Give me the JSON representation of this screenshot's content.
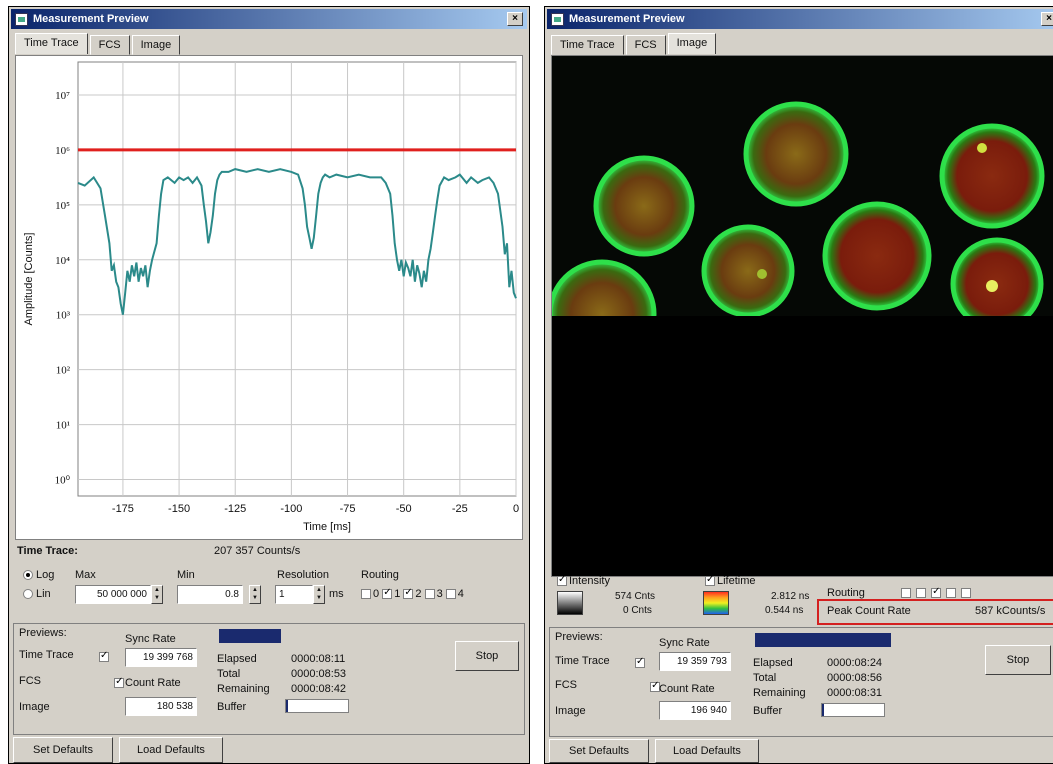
{
  "left_window": {
    "title": "Measurement Preview",
    "close_glyph": "×",
    "tabs": [
      "Time Trace",
      "FCS",
      "Image"
    ],
    "active_tab": "Time Trace",
    "chart_data": {
      "type": "line",
      "xlabel": "Time [ms]",
      "ylabel": "Amplitude [Counts]",
      "x_ticks": [
        "-175",
        "-150",
        "-125",
        "-100",
        "-75",
        "-50",
        "-25",
        "0"
      ],
      "y_ticks": [
        "10⁷",
        "10⁶",
        "10⁵",
        "10⁴",
        "10³",
        "10²",
        "10¹",
        "10⁰"
      ],
      "xlim": [
        -195,
        0
      ],
      "ylim_log10": [
        -0.3,
        7.6
      ],
      "log_scale": true,
      "grid": true,
      "threshold": {
        "value_log10": 6.0,
        "color": "#e0201e"
      },
      "series": [
        {
          "color": "#2b8a8a",
          "x": [
            -195,
            -192,
            -188,
            -185,
            -183,
            -181,
            -180,
            -179,
            -178,
            -177,
            -176,
            -175,
            -174,
            -173,
            -172,
            -171,
            -170,
            -169,
            -168,
            -167,
            -166,
            -165,
            -164,
            -163,
            -162,
            -160,
            -159,
            -158,
            -157,
            -155,
            -152,
            -150,
            -148,
            -146,
            -144,
            -142,
            -140,
            -139,
            -138,
            -137,
            -136,
            -135,
            -134,
            -133,
            -132,
            -131,
            -130,
            -128,
            -125,
            -120,
            -115,
            -110,
            -105,
            -100,
            -97,
            -95,
            -94,
            -93,
            -92,
            -91,
            -90,
            -89,
            -88,
            -87,
            -86,
            -85,
            -83,
            -80,
            -75,
            -70,
            -65,
            -60,
            -58,
            -56,
            -55,
            -54,
            -53,
            -52,
            -51,
            -50,
            -49,
            -48,
            -47,
            -46,
            -45,
            -44,
            -43,
            -42,
            -41,
            -40,
            -39,
            -38,
            -37,
            -36,
            -35,
            -34,
            -32,
            -30,
            -27,
            -25,
            -22,
            -20,
            -17,
            -15,
            -12,
            -10,
            -8,
            -6,
            -5,
            -4,
            -3,
            -2,
            -1,
            0
          ],
          "y_log10": [
            5.4,
            5.35,
            5.5,
            5.3,
            4.8,
            4.3,
            3.8,
            3.9,
            3.6,
            3.5,
            3.2,
            3.0,
            3.4,
            3.8,
            3.6,
            3.9,
            3.7,
            3.95,
            3.6,
            3.85,
            3.7,
            3.9,
            3.5,
            3.8,
            4.0,
            4.3,
            4.8,
            5.2,
            5.45,
            5.5,
            5.4,
            5.5,
            5.45,
            5.5,
            5.4,
            5.5,
            5.35,
            5.0,
            4.7,
            4.3,
            4.5,
            4.8,
            5.2,
            5.45,
            5.55,
            5.6,
            5.6,
            5.6,
            5.65,
            5.6,
            5.65,
            5.6,
            5.65,
            5.6,
            5.55,
            5.3,
            5.0,
            4.6,
            4.4,
            4.2,
            4.4,
            4.8,
            5.2,
            5.4,
            5.5,
            5.55,
            5.5,
            5.55,
            5.5,
            5.55,
            5.5,
            5.5,
            5.4,
            5.2,
            4.8,
            4.3,
            4.0,
            3.8,
            4.0,
            3.7,
            3.95,
            3.85,
            3.7,
            4.0,
            3.6,
            3.9,
            3.75,
            3.5,
            3.8,
            3.6,
            4.0,
            4.2,
            4.5,
            4.8,
            5.1,
            5.35,
            5.5,
            5.45,
            5.5,
            5.55,
            5.4,
            5.5,
            5.4,
            5.45,
            5.5,
            5.4,
            5.2,
            4.6,
            4.1,
            4.3,
            3.5,
            3.8,
            3.4,
            3.3
          ]
        }
      ]
    },
    "time_trace_label": "Time Trace:",
    "time_trace_value": "207 357 Counts/s",
    "log_label": "Log",
    "lin_label": "Lin",
    "max_label": "Max",
    "max_value": "50 000 000",
    "min_label": "Min",
    "min_value": "0.8",
    "resolution_label": "Resolution",
    "resolution_value": "1",
    "resolution_unit": "ms",
    "routing_label": "Routing",
    "routing_channels": [
      {
        "label": "0",
        "checked": false
      },
      {
        "label": "1",
        "checked": true
      },
      {
        "label": "2",
        "checked": true
      },
      {
        "label": "3",
        "checked": false
      },
      {
        "label": "4",
        "checked": false
      }
    ],
    "previews_label": "Previews:",
    "preview_items": [
      {
        "label": "Time Trace",
        "checked": true
      },
      {
        "label": "FCS",
        "checked": true
      },
      {
        "label": "Image",
        "checked": true
      }
    ],
    "sync_rate_label": "Sync Rate",
    "sync_rate_value": "19 399 768",
    "count_rate_label": "Count Rate",
    "count_rate_value": "180 538",
    "elapsed_label": "Elapsed",
    "elapsed_value": "0000:08:11",
    "total_label": "Total",
    "total_value": "0000:08:53",
    "remaining_label": "Remaining",
    "remaining_value": "0000:08:42",
    "buffer_label": "Buffer",
    "buffer_fill": 0.04,
    "stop_label": "Stop",
    "set_defaults_label": "Set Defaults",
    "load_defaults_label": "Load Defaults"
  },
  "right_window": {
    "title": "Measurement Preview",
    "close_glyph": "×",
    "tabs": [
      "Time Trace",
      "FCS",
      "Image"
    ],
    "active_tab": "Image",
    "intensity_label": "Intensity",
    "intensity_max": "574 Cnts",
    "intensity_min": "0 Cnts",
    "lifetime_label": "Lifetime",
    "lifetime_max": "2.812 ns",
    "lifetime_min": "0.544 ns",
    "routing_label": "Routing",
    "routing_channels": [
      {
        "checked": false
      },
      {
        "checked": false
      },
      {
        "checked": true
      },
      {
        "checked": false
      },
      {
        "checked": false
      }
    ],
    "peak_count_label": "Peak Count Rate",
    "peak_count_value": "587 kCounts/s",
    "previews_label": "Previews:",
    "preview_items": [
      {
        "label": "Time Trace",
        "checked": true
      },
      {
        "label": "FCS",
        "checked": true
      },
      {
        "label": "Image",
        "checked": true
      }
    ],
    "sync_rate_label": "Sync Rate",
    "sync_rate_value": "19 359 793",
    "count_rate_label": "Count Rate",
    "count_rate_value": "196 940",
    "elapsed_label": "Elapsed",
    "elapsed_value": "0000:08:24",
    "total_label": "Total",
    "total_value": "0000:08:56",
    "remaining_label": "Remaining",
    "remaining_value": "0000:08:31",
    "buffer_label": "Buffer",
    "buffer_fill": 0.04,
    "stop_label": "Stop",
    "set_defaults_label": "Set Defaults",
    "load_defaults_label": "Load Defaults"
  }
}
